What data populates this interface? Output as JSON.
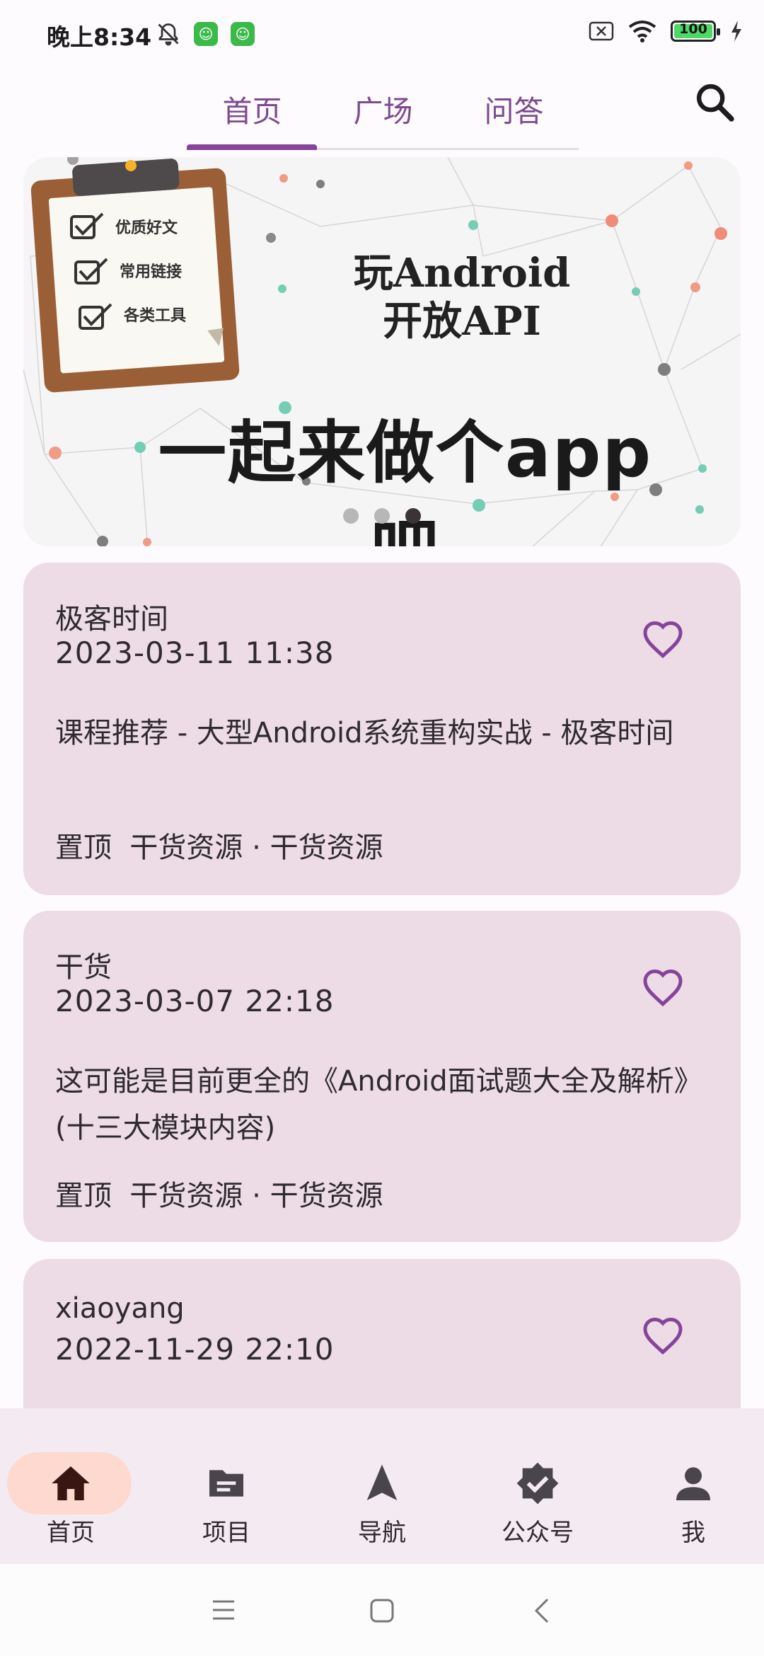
{
  "status_bar": {
    "time": "晚上8:34",
    "battery": "100"
  },
  "tabs": [
    {
      "label": "首页",
      "active": true
    },
    {
      "label": "广场",
      "active": false
    },
    {
      "label": "问答",
      "active": false
    }
  ],
  "search": {
    "icon": "search-icon"
  },
  "banner": {
    "title_line1": "玩Android",
    "title_line2": "开放API",
    "slogan": "一起来做个app吧",
    "checklist": [
      "优质好文",
      "常用链接",
      "各类工具"
    ],
    "page_count": 3,
    "active_index": 2
  },
  "articles": [
    {
      "author": "极客时间",
      "date": "2023-03-11 11:38",
      "title": "课程推荐 - 大型Android系统重构实战 - 极客时间",
      "tags": "置顶  干货资源 · 干货资源"
    },
    {
      "author": "干货",
      "date": "2023-03-07 22:18",
      "title": "这可能是目前更全的《Android面试题大全及解析》(十三大模块内容)",
      "tags": "置顶  干货资源 · 干货资源"
    },
    {
      "author": "xiaoyang",
      "date": "2022-11-29 22:10"
    }
  ],
  "bottom_nav": [
    {
      "label": "首页",
      "icon": "home-icon",
      "active": true
    },
    {
      "label": "项目",
      "icon": "folder-icon",
      "active": false
    },
    {
      "label": "导航",
      "icon": "navigation-arrow-icon",
      "active": false
    },
    {
      "label": "公众号",
      "icon": "verified-badge-icon",
      "active": false
    },
    {
      "label": "我",
      "icon": "person-icon",
      "active": false
    }
  ],
  "colors": {
    "accent": "#86439a",
    "card_bg": "#eddce5",
    "nav_pill": "#fdd9cf",
    "nav_bg": "#f4eaf2"
  }
}
